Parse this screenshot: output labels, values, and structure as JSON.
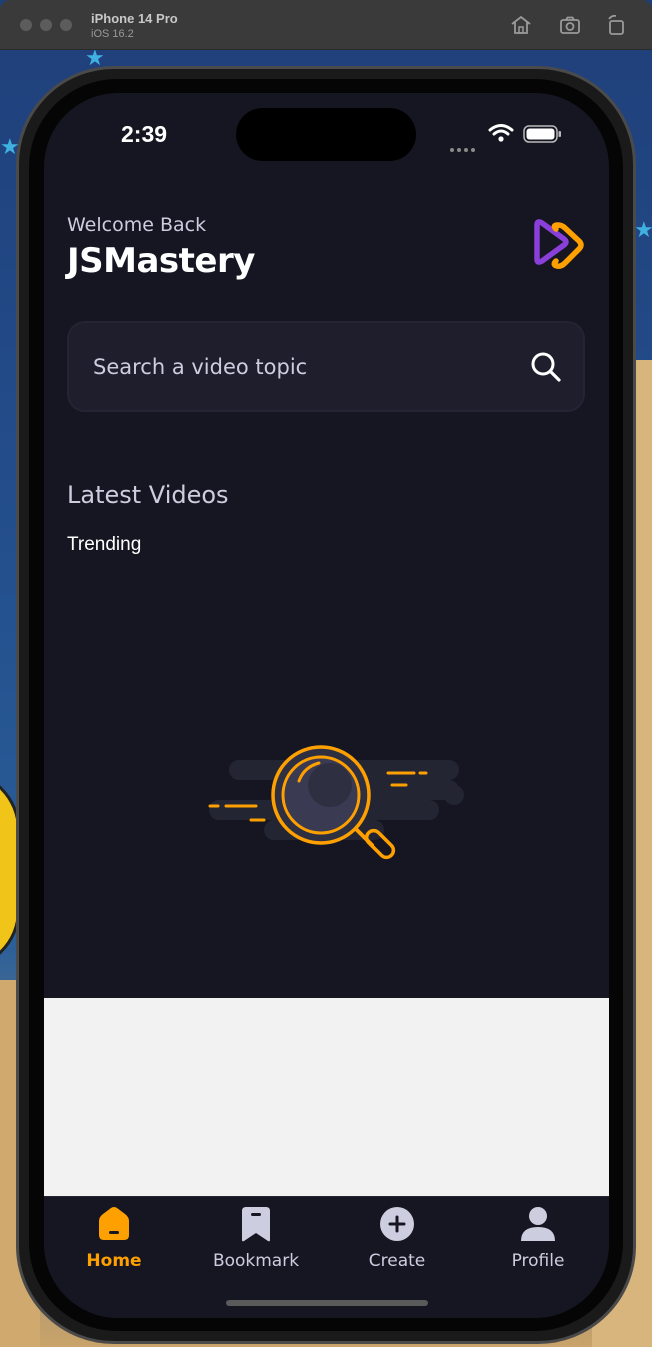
{
  "simulator": {
    "device_name": "iPhone 14 Pro",
    "os_version": "iOS 16.2"
  },
  "status_bar": {
    "time": "2:39"
  },
  "header": {
    "greeting": "Welcome Back",
    "username": "JSMastery"
  },
  "search": {
    "placeholder": "Search a video topic"
  },
  "sections": {
    "latest_title": "Latest Videos",
    "trending_label": "Trending"
  },
  "tabs": [
    {
      "label": "Home",
      "icon": "home-icon",
      "active": true
    },
    {
      "label": "Bookmark",
      "icon": "bookmark-icon",
      "active": false
    },
    {
      "label": "Create",
      "icon": "plus-circle-icon",
      "active": false
    },
    {
      "label": "Profile",
      "icon": "profile-icon",
      "active": false
    }
  ],
  "colors": {
    "background": "#161622",
    "accent": "#ffa001",
    "search_bg": "#1e1e2d",
    "text_muted": "#cdcde0",
    "logo_purple": "#8b3fd9"
  }
}
